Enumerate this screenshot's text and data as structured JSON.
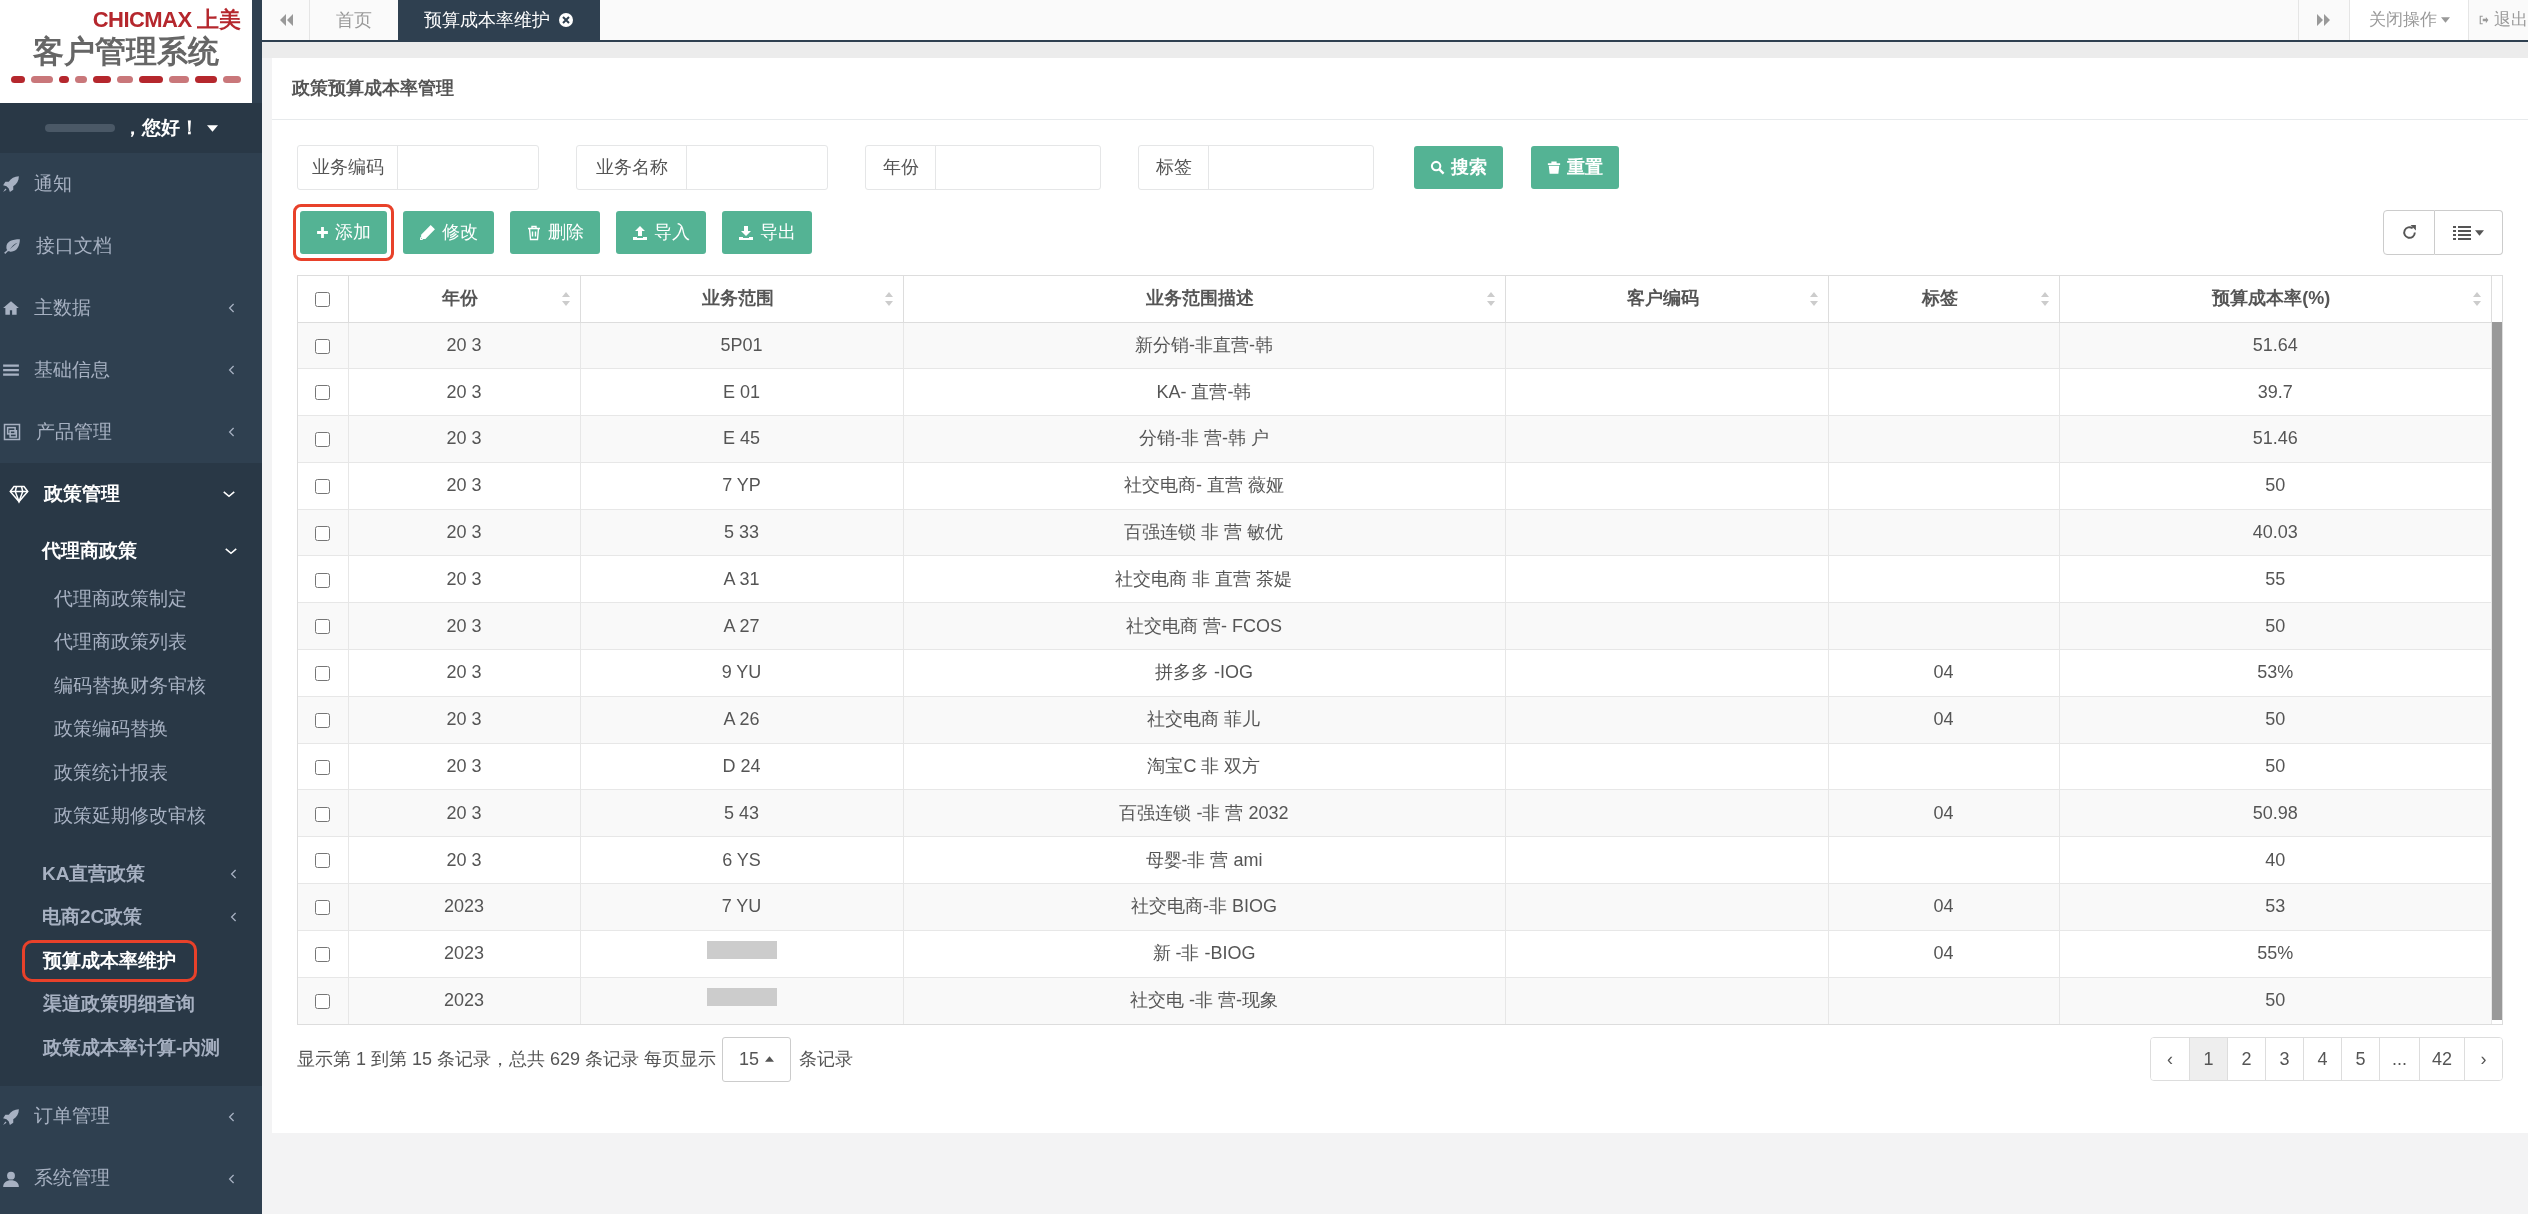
{
  "sidebar": {
    "logo": {
      "brand": "CHICMAX 上美",
      "title": "客户管理系统"
    },
    "greeting": "，您好！",
    "nav": [
      {
        "label": "通知"
      },
      {
        "label": "接口文档"
      },
      {
        "label": "主数据",
        "expanded": false
      },
      {
        "label": "基础信息",
        "expanded": false
      },
      {
        "label": "产品管理",
        "expanded": false
      },
      {
        "label": "政策管理",
        "expanded": true,
        "children": [
          {
            "label": "代理商政策",
            "expanded": true,
            "children": [
              {
                "label": "代理商政策制定",
                "selected": false
              },
              {
                "label": "代理商政策列表",
                "selected": false
              },
              {
                "label": "编码替换财务审核",
                "selected": false
              },
              {
                "label": "政策编码替换",
                "selected": false
              },
              {
                "label": "政策统计报表",
                "selected": false
              },
              {
                "label": "政策延期修改审核",
                "selected": false
              }
            ]
          },
          {
            "label": "KA直营政策",
            "expanded": false
          },
          {
            "label": "电商2C政策",
            "expanded": false
          },
          {
            "label": "预算成本率维护",
            "selected": true,
            "highlighted": true
          },
          {
            "label": "渠道政策明细查询",
            "selected": false,
            "highlighted": false
          },
          {
            "label": "政策成本率计算-内测",
            "selected": false,
            "highlighted": false
          }
        ]
      },
      {
        "label": "订单管理",
        "expanded": false
      },
      {
        "label": "系统管理",
        "expanded": false
      }
    ]
  },
  "tabs": [
    {
      "label": "首页",
      "selected": false,
      "closable": false
    },
    {
      "label": "预算成本率维护",
      "selected": true,
      "closable": true
    }
  ],
  "top_actions": {
    "close_menu": "关闭操作",
    "logout": "退出"
  },
  "panel": {
    "title": "政策预算成本率管理",
    "filters": [
      {
        "label": "业务编码"
      },
      {
        "label": "业务名称"
      },
      {
        "label": "年份"
      },
      {
        "label": "标签"
      }
    ],
    "search_buttons": [
      "搜索",
      "重置"
    ],
    "toolbar": [
      {
        "label": "添加",
        "highlighted": true
      },
      {
        "label": "修改",
        "highlighted": false
      },
      {
        "label": "删除",
        "highlighted": false
      },
      {
        "label": "导入",
        "highlighted": false
      },
      {
        "label": "导出",
        "highlighted": false
      }
    ],
    "table": {
      "all_checked": false,
      "columns": [
        "年份",
        "业务范围",
        "业务范围描述",
        "客户编码",
        "标签",
        "预算成本率(%)"
      ],
      "rows": [
        {
          "year": "20 3",
          "scope": "5P01",
          "desc": "新分销-非直营-韩",
          "rate": "51.64",
          "checked": false
        },
        {
          "year": "20 3",
          "scope": "E 01",
          "desc": "KA- 直营-韩",
          "rate": "39.7",
          "checked": false
        },
        {
          "year": "20 3",
          "scope": "E 45",
          "desc": "分销-非 营-韩 户",
          "rate": "51.46",
          "checked": false
        },
        {
          "year": "20 3",
          "scope": "7 YP",
          "desc": "社交电商- 直营 薇娅",
          "rate": "50",
          "checked": false
        },
        {
          "year": "20 3",
          "scope": "5 33",
          "desc": "百强连锁 非 营 敏优",
          "rate": "40.03",
          "checked": false
        },
        {
          "year": "20 3",
          "scope": "A 31",
          "desc": "社交电商 非 直营 茶媞",
          "rate": "55",
          "checked": false
        },
        {
          "year": "20 3",
          "scope": "A 27",
          "desc": "社交电商 营- FCOS",
          "rate": "50",
          "checked": false
        },
        {
          "year": "20 3",
          "scope": "9 YU",
          "desc": "拼多多 -IOG",
          "tag": "04",
          "rate": "53%",
          "checked": false
        },
        {
          "year": "20 3",
          "scope": "A 26",
          "desc": "社交电商 菲儿",
          "tag": "04",
          "rate": "50",
          "checked": false
        },
        {
          "year": "20 3",
          "scope": "D 24",
          "desc": "淘宝C 非 双方",
          "rate": "50",
          "checked": false
        },
        {
          "year": "20 3",
          "scope": "5 43",
          "desc": "百强连锁 -非 营 2032",
          "tag": "04",
          "rate": "50.98",
          "checked": false
        },
        {
          "year": "20 3",
          "scope": "6 YS",
          "desc": "母婴-非 营 ami",
          "rate": "40",
          "checked": false
        },
        {
          "year": "2023",
          "scope": "7 YU",
          "desc": "社交电商-非 BIOG",
          "tag": "04",
          "rate": "53",
          "checked": false
        },
        {
          "year": "2023",
          "desc": "新 -非 -BIOG",
          "tag": "04",
          "rate": "55%",
          "checked": false
        },
        {
          "year": "2023",
          "desc": "社交电 -非 营-现象",
          "rate": "50",
          "checked": false
        }
      ]
    },
    "pagination": {
      "info": "显示第 1 到第 15 条记录，总共 629 条记录 每页显示",
      "page_size": "15",
      "suffix": "条记录",
      "pages": [
        {
          "label": "‹",
          "selected": false
        },
        {
          "label": "1",
          "selected": true
        },
        {
          "label": "2",
          "selected": false
        },
        {
          "label": "3",
          "selected": false
        },
        {
          "label": "4",
          "selected": false
        },
        {
          "label": "5",
          "selected": false
        },
        {
          "label": "...",
          "selected": false
        },
        {
          "label": "42",
          "selected": false
        },
        {
          "label": "›",
          "selected": false
        }
      ]
    }
  }
}
